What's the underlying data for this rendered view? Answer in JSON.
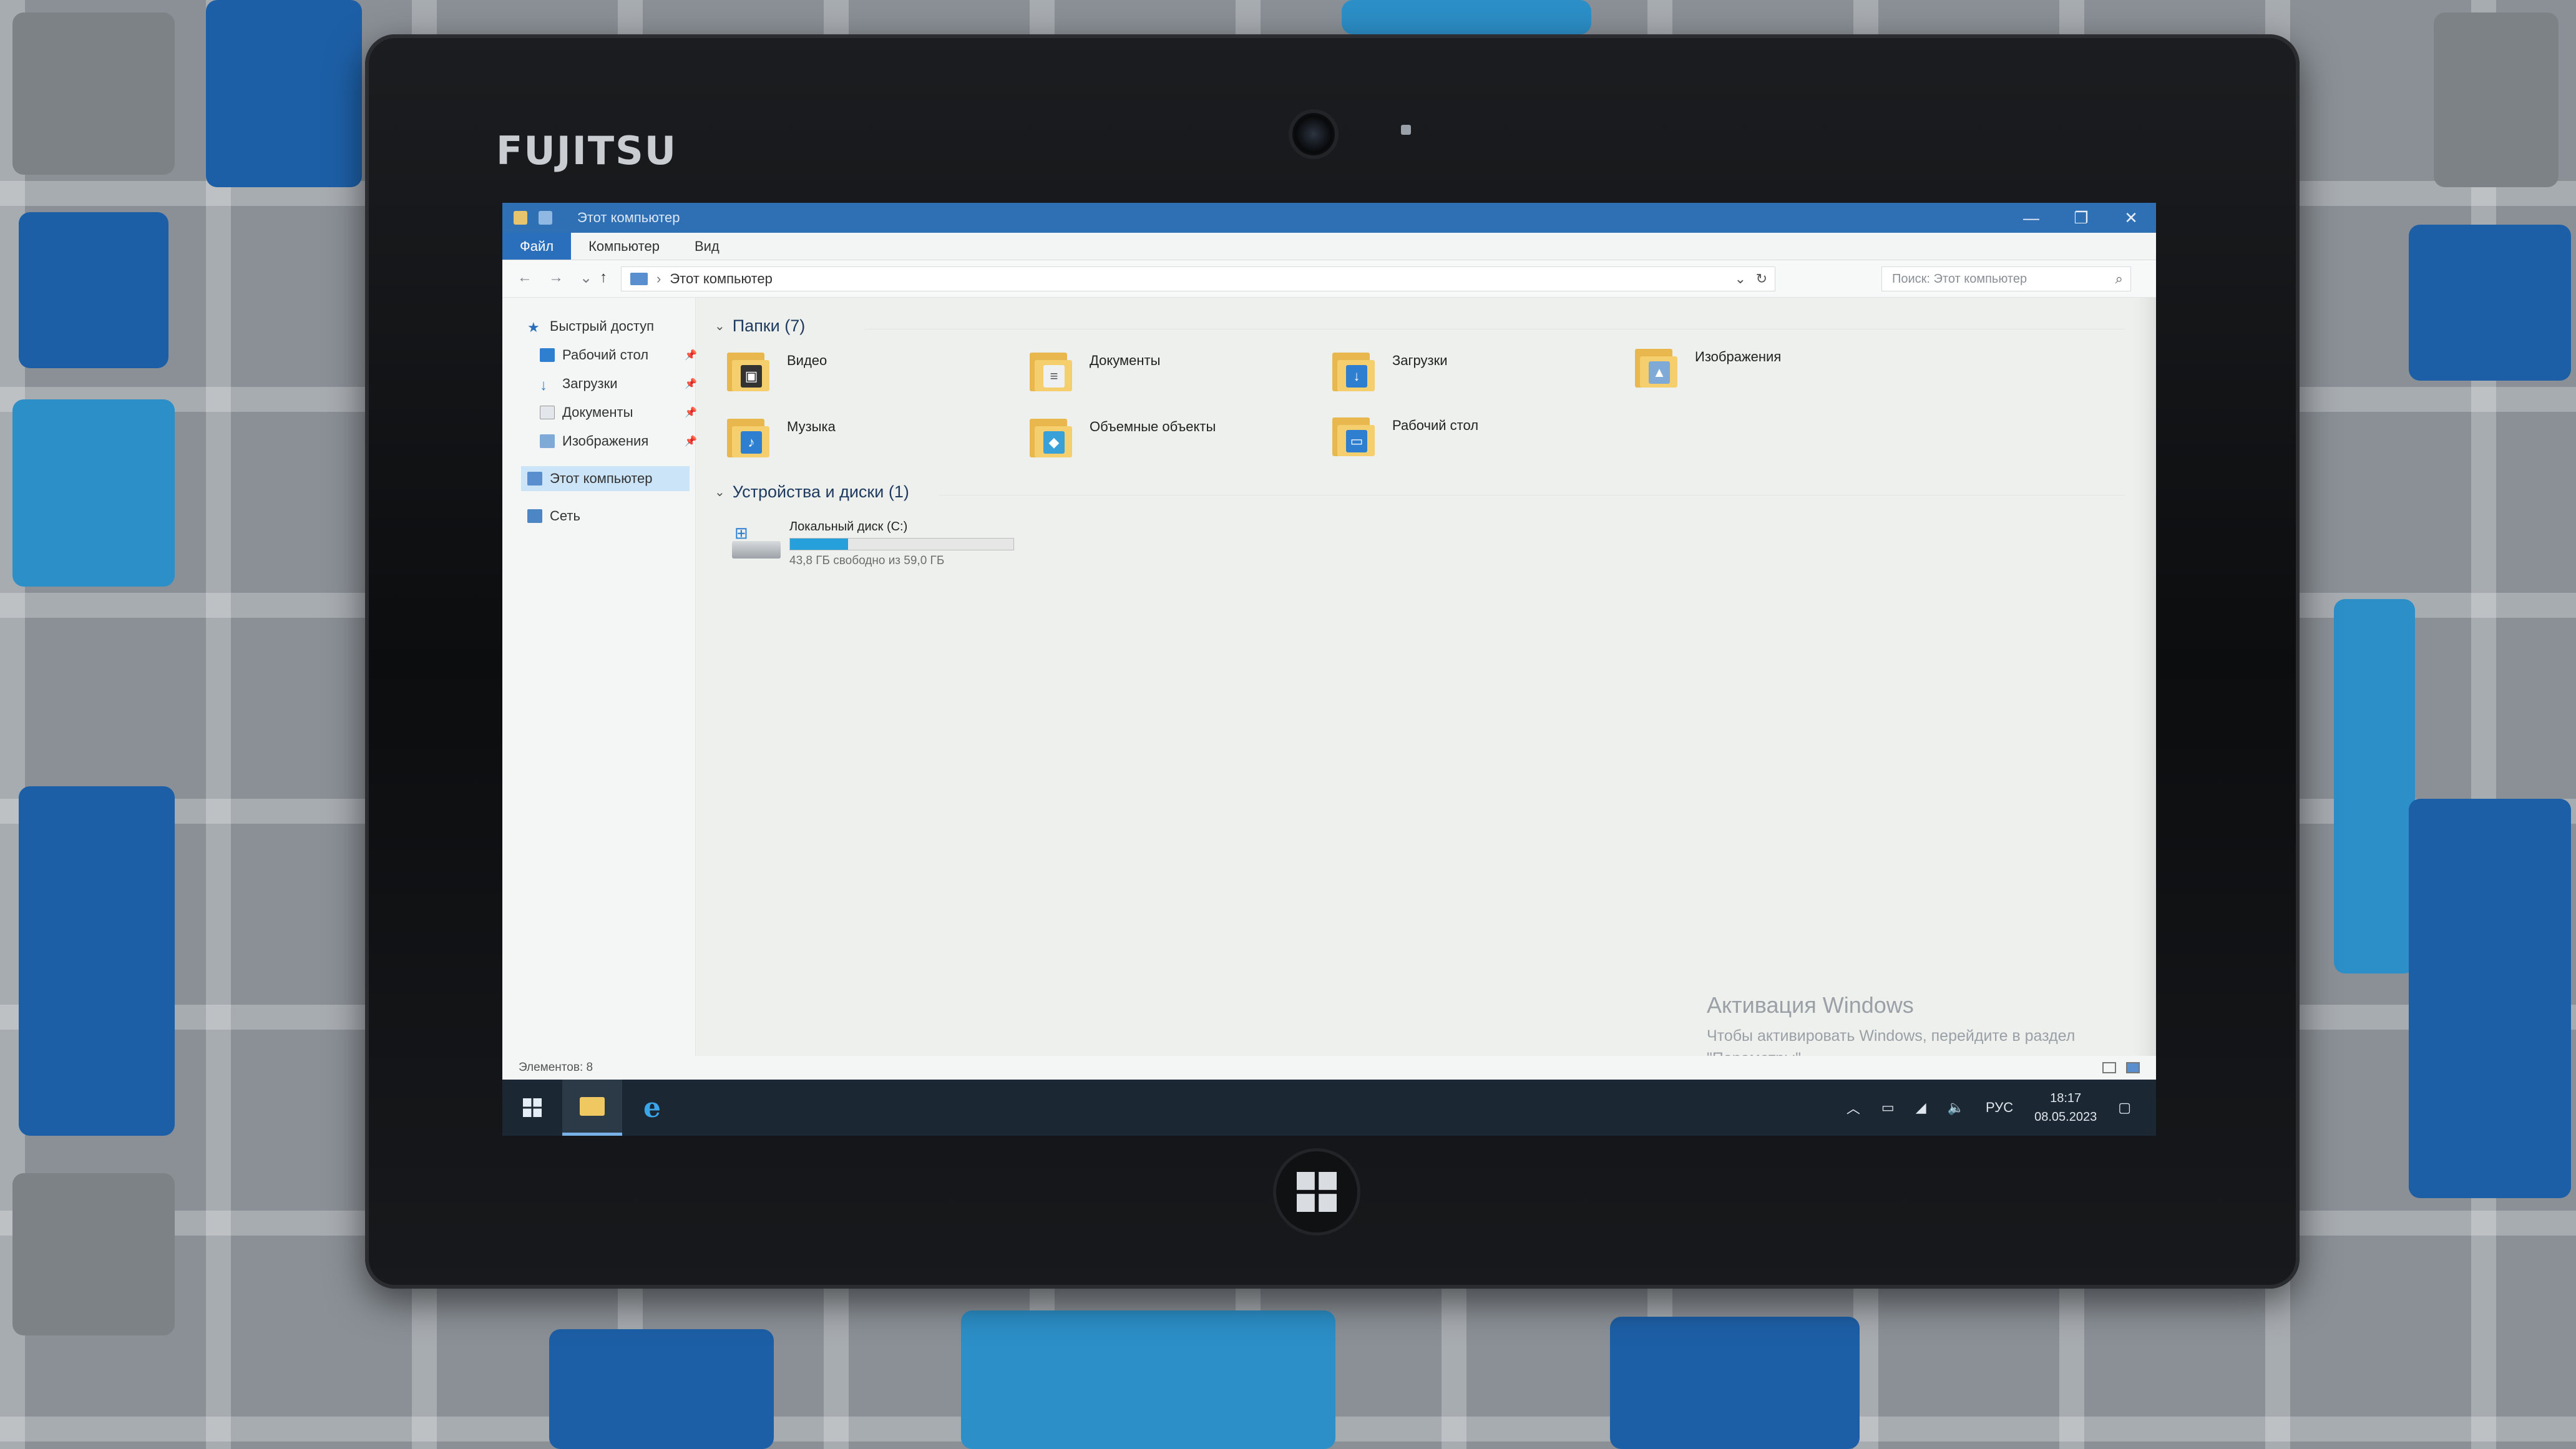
{
  "tablet": {
    "brand": "FUJITSU"
  },
  "window": {
    "title": "Этот компьютер",
    "controls": {
      "minimize": "—",
      "maximize": "❐",
      "close": "✕"
    }
  },
  "ribbon": {
    "tabs": [
      "Файл",
      "Компьютер",
      "Вид"
    ]
  },
  "address": {
    "path": "Этот компьютер",
    "search_placeholder": "Поиск: Этот компьютер"
  },
  "navpane": {
    "quick_access": "Быстрый доступ",
    "pinned": [
      "Рабочий стол",
      "Загрузки",
      "Документы",
      "Изображения"
    ],
    "this_pc": "Этот компьютер",
    "network": "Сеть"
  },
  "folders": {
    "header": "Папки (7)",
    "items": [
      "Видео",
      "Документы",
      "Загрузки",
      "Изображения",
      "Музыка",
      "Объемные объекты",
      "Рабочий стол"
    ]
  },
  "devices": {
    "header": "Устройства и диски (1)",
    "drive": {
      "name": "Локальный диск (C:)",
      "free_text": "43,8 ГБ свободно из 59,0 ГБ",
      "used_fraction": 0.26
    }
  },
  "status": {
    "items_count": "Элементов: 8"
  },
  "watermark": {
    "title": "Активация Windows",
    "text": "Чтобы активировать Windows, перейдите в раздел \"Параметры\"."
  },
  "taskbar": {
    "language": "РУС",
    "time": "18:17",
    "date": "08.05.2023"
  },
  "colors": {
    "accent": "#2f6fb4",
    "taskbar": "#1b2733",
    "folder": "#f5cf6e"
  }
}
